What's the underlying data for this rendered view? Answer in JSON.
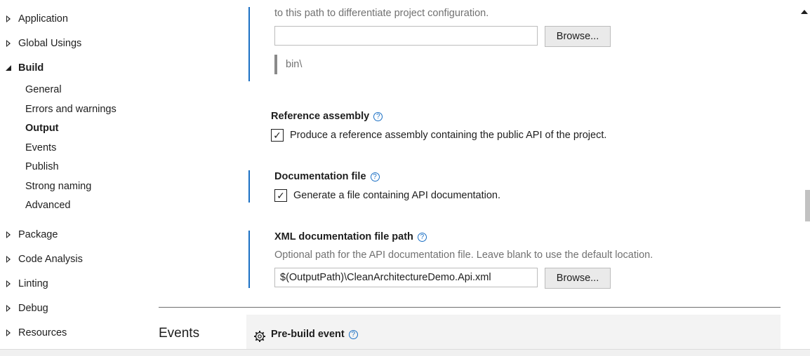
{
  "sidebar": {
    "groups": [
      {
        "label": "Application"
      },
      {
        "label": "Global Usings"
      },
      {
        "label": "Build"
      },
      {
        "label": "Package"
      },
      {
        "label": "Code Analysis"
      },
      {
        "label": "Linting"
      },
      {
        "label": "Debug"
      },
      {
        "label": "Resources"
      }
    ],
    "build_children": [
      {
        "label": "General"
      },
      {
        "label": "Errors and warnings"
      },
      {
        "label": "Output"
      },
      {
        "label": "Events"
      },
      {
        "label": "Publish"
      },
      {
        "label": "Strong naming"
      },
      {
        "label": "Advanced"
      }
    ],
    "selected": "Output"
  },
  "output_path": {
    "description_tail": "to this path to differentiate project configuration.",
    "value": "",
    "browse_label": "Browse...",
    "preview": "bin\\"
  },
  "reference_assembly": {
    "heading": "Reference assembly",
    "help_glyph": "?",
    "checkbox_label": "Produce a reference assembly containing the public API of the project.",
    "checked": true
  },
  "documentation_file": {
    "heading": "Documentation file",
    "help_glyph": "?",
    "checkbox_label": "Generate a file containing API documentation.",
    "checked": true
  },
  "xml_doc_path": {
    "heading": "XML documentation file path",
    "help_glyph": "?",
    "description": "Optional path for the API documentation file. Leave blank to use the default location.",
    "value": "$(OutputPath)\\CleanArchitectureDemo.Api.xml",
    "browse_label": "Browse..."
  },
  "events_section": {
    "title": "Events",
    "prebuild_heading": "Pre-build event",
    "help_glyph": "?"
  },
  "check_glyph": "✓",
  "colors": {
    "accent": "#1a6fc4",
    "text": "#1e1e1e",
    "muted": "#717171"
  }
}
